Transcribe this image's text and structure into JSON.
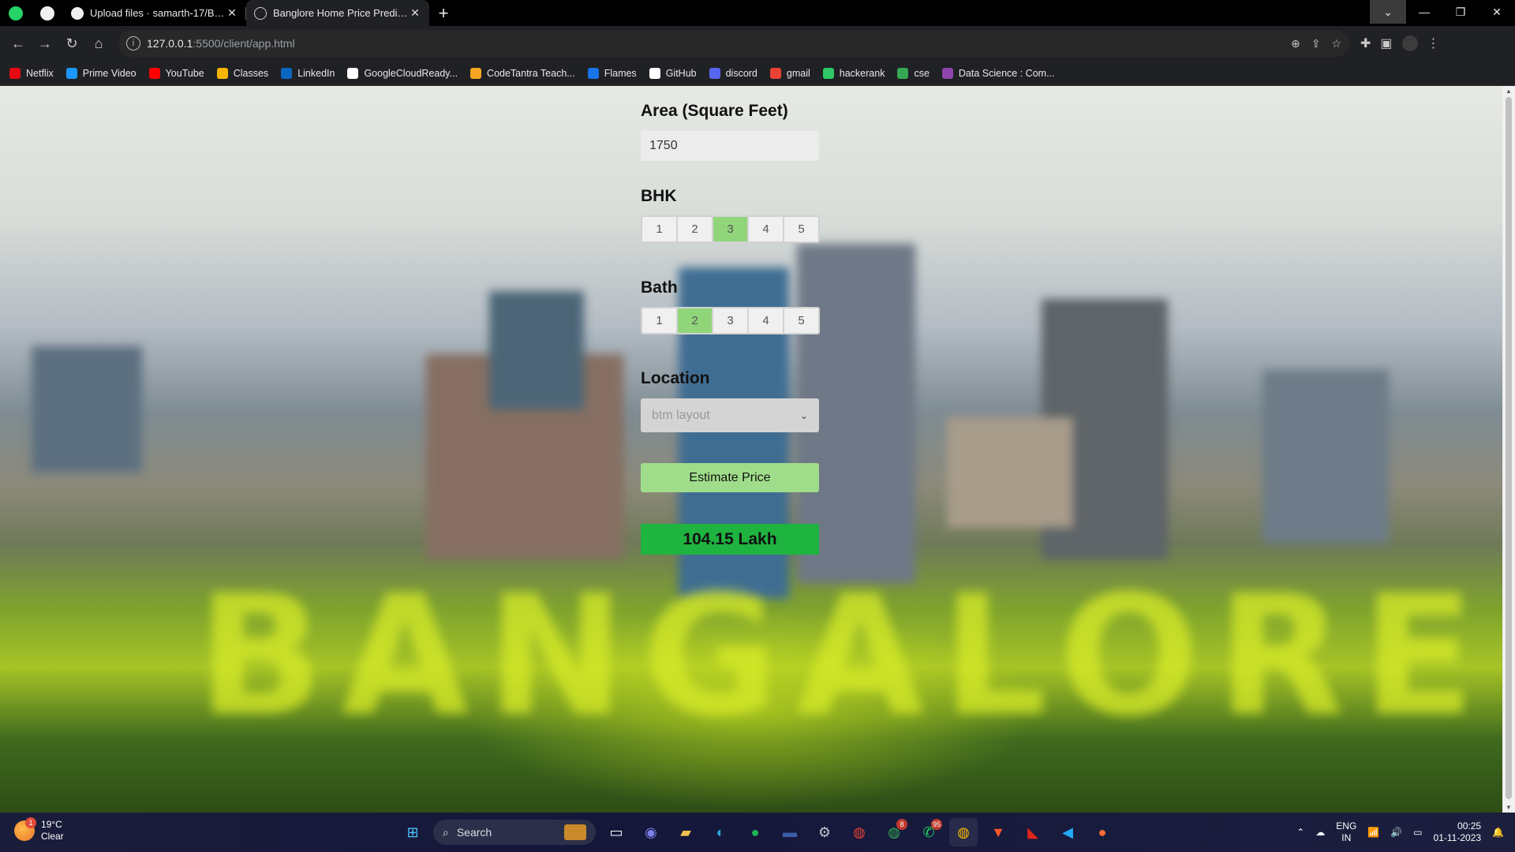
{
  "browser": {
    "tabs": [
      {
        "title": "Upload files · samarth-17/Banglore",
        "active": false
      },
      {
        "title": "Banglore Home Price Prediction",
        "active": true
      }
    ],
    "url_host": "127.0.0.1",
    "url_path": ":5500/client/app.html",
    "bookmarks": [
      {
        "label": "Netflix",
        "icon": "netflix-icon",
        "color": "#e50914"
      },
      {
        "label": "Prime Video",
        "icon": "prime-video-icon",
        "color": "#1a98ff"
      },
      {
        "label": "YouTube",
        "icon": "youtube-icon",
        "color": "#ff0000"
      },
      {
        "label": "Classes",
        "icon": "classroom-icon",
        "color": "#f4b400"
      },
      {
        "label": "LinkedIn",
        "icon": "linkedin-icon",
        "color": "#0a66c2"
      },
      {
        "label": "GoogleCloudReady...",
        "icon": "google-icon",
        "color": "#ffffff"
      },
      {
        "label": "CodeTantra Teach...",
        "icon": "codetantra-icon",
        "color": "#f5a623"
      },
      {
        "label": "Flames",
        "icon": "flames-icon",
        "color": "#1a73e8"
      },
      {
        "label": "GitHub",
        "icon": "github-icon",
        "color": "#ffffff"
      },
      {
        "label": "discord",
        "icon": "discord-icon",
        "color": "#5865f2"
      },
      {
        "label": "gmail",
        "icon": "gmail-icon",
        "color": "#ea4335"
      },
      {
        "label": "hackerank",
        "icon": "hackerrank-icon",
        "color": "#2ec866"
      },
      {
        "label": "cse",
        "icon": "drive-icon",
        "color": "#34a853"
      },
      {
        "label": "Data Science : Com...",
        "icon": "course-icon",
        "color": "#8e44ad"
      }
    ]
  },
  "app": {
    "area_label": "Area (Square Feet)",
    "area_value": "1750",
    "bhk_label": "BHK",
    "bhk_options": [
      "1",
      "2",
      "3",
      "4",
      "5"
    ],
    "bhk_selected": "3",
    "bath_label": "Bath",
    "bath_options": [
      "1",
      "2",
      "3",
      "4",
      "5"
    ],
    "bath_selected": "2",
    "location_label": "Location",
    "location_value": "btm layout",
    "estimate_button": "Estimate Price",
    "result": "104.15 Lakh",
    "background_word": "BANGALORE"
  },
  "taskbar": {
    "weather_temp": "19°C",
    "weather_desc": "Clear",
    "weather_badge": "1",
    "search_placeholder": "Search",
    "apps": [
      {
        "name": "start-icon",
        "glyph": "⊞",
        "color": "#4cc2ff"
      },
      {
        "name": "search"
      },
      {
        "name": "task-view-icon",
        "glyph": "▭",
        "color": "#ffffff"
      },
      {
        "name": "teams-icon",
        "glyph": "◉",
        "color": "#7b83eb"
      },
      {
        "name": "file-explorer-icon",
        "glyph": "▰",
        "color": "#f2c14e"
      },
      {
        "name": "edge-icon",
        "glyph": "◐",
        "color": "#29a8e0"
      },
      {
        "name": "spotify-icon",
        "glyph": "●",
        "color": "#1db954"
      },
      {
        "name": "terminal-icon",
        "glyph": "▬",
        "color": "#3b5ea8"
      },
      {
        "name": "settings-icon",
        "glyph": "⚙",
        "color": "#bfc6d1"
      },
      {
        "name": "chrome-icon",
        "glyph": "◍",
        "color": "#e94235"
      },
      {
        "name": "chrome-profile-icon",
        "glyph": "◍",
        "color": "#34a853",
        "badge": "8"
      },
      {
        "name": "whatsapp-icon",
        "glyph": "✆",
        "color": "#25d366",
        "badge": "95"
      },
      {
        "name": "chrome-active-icon",
        "glyph": "◍",
        "color": "#fbbc05"
      },
      {
        "name": "brave-icon",
        "glyph": "▼",
        "color": "#fb542b"
      },
      {
        "name": "acrobat-icon",
        "glyph": "◣",
        "color": "#e0251b"
      },
      {
        "name": "vscode-icon",
        "glyph": "◀",
        "color": "#23a9f2"
      },
      {
        "name": "postman-icon",
        "glyph": "●",
        "color": "#ff6c37"
      }
    ],
    "lang_1": "ENG",
    "lang_2": "IN",
    "time": "00:25",
    "date": "01-11-2023"
  }
}
